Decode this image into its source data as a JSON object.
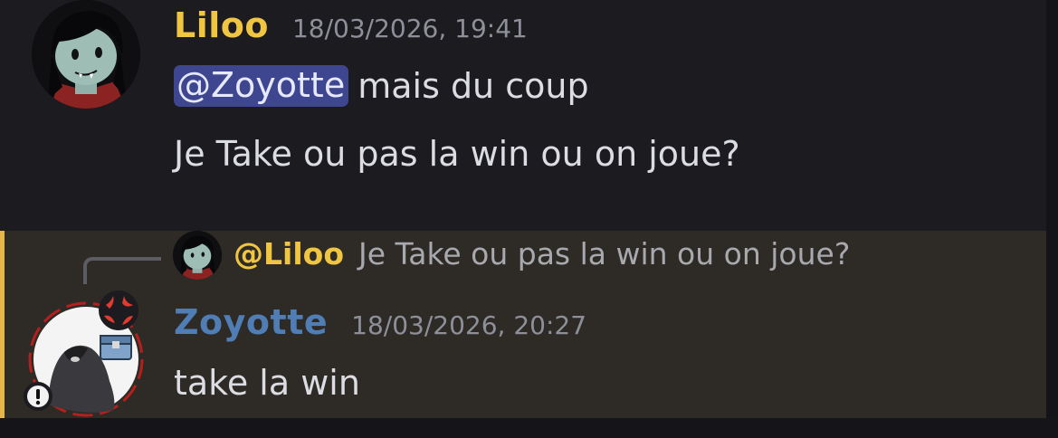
{
  "messages": [
    {
      "author": "Liloo",
      "author_color": "#f0c542",
      "timestamp": "18/03/2026, 19:41",
      "lines": [
        {
          "mention": "@Zoyotte",
          "text": "mais du coup"
        },
        {
          "text": "Je Take ou pas la win ou on joue?"
        }
      ]
    },
    {
      "reply_to": {
        "author": "@Liloo",
        "text": "Je Take ou pas la win ou on joue?"
      },
      "author": "Zoyotte",
      "author_color": "#4f7db4",
      "timestamp": "18/03/2026, 20:27",
      "lines": [
        {
          "text": "take la win"
        }
      ],
      "highlight_color": "#e5b54a"
    }
  ],
  "icons": {
    "avatar_liloo": "vampire-girl-avatar",
    "avatar_zoyotte": "hooded-figure-avatar",
    "angry_emoji": "anger-symbol-icon",
    "warning_badge": "exclamation-icon"
  }
}
